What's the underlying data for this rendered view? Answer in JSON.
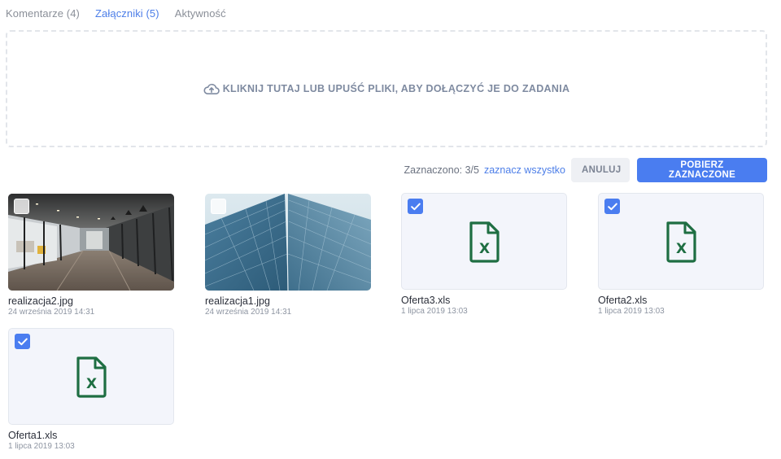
{
  "tabs": [
    {
      "label": "Komentarze (4)",
      "active": false
    },
    {
      "label": "Załączniki (5)",
      "active": true
    },
    {
      "label": "Aktywność",
      "active": false
    }
  ],
  "dropzone": {
    "icon": "cloud-upload-icon",
    "text": "KLIKNIJ TUTAJ LUB UPUŚĆ PLIKI, ABY DOŁĄCZYĆ JE DO ZADANIA"
  },
  "selection": {
    "count_text": "Zaznaczono: 3/5",
    "select_all_label": "zaznacz wszystko",
    "cancel_label": "ANULUJ",
    "download_label": "POBIERZ ZAZNACZONE"
  },
  "files": [
    {
      "name": "realizacja2.jpg",
      "date": "24 września 2019 14:31",
      "type": "image",
      "checked": false
    },
    {
      "name": "realizacja1.jpg",
      "date": "24 września 2019 14:31",
      "type": "image",
      "checked": false
    },
    {
      "name": "Oferta3.xls",
      "date": "1 lipca 2019 13:03",
      "type": "xls",
      "checked": true
    },
    {
      "name": "Oferta2.xls",
      "date": "1 lipca 2019 13:03",
      "type": "xls",
      "checked": true
    },
    {
      "name": "Oferta1.xls",
      "date": "1 lipca 2019 13:03",
      "type": "xls",
      "checked": true
    }
  ],
  "colors": {
    "accent": "#4a7df0",
    "excel": "#1e6e42",
    "card_bg": "#f3f5fb"
  }
}
